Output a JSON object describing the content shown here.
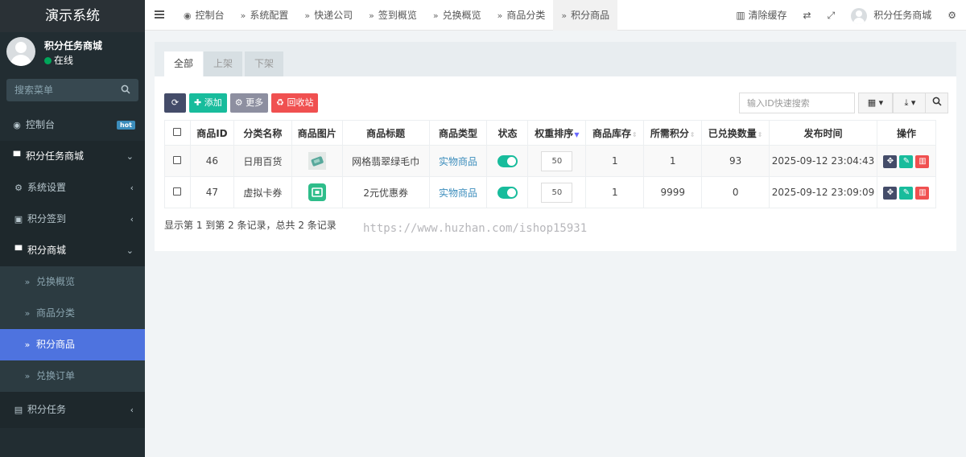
{
  "sidebar": {
    "logo": "演示系统",
    "user": {
      "name": "积分任务商城",
      "status": "在线"
    },
    "search_placeholder": "搜索菜单",
    "hot_badge": "hot",
    "items": [
      {
        "label": "控制台",
        "icon": "dashboard-icon"
      },
      {
        "label": "积分任务商城",
        "icon": "shopping-bag-icon"
      },
      {
        "label": "系统设置",
        "icon": "cogs-icon"
      },
      {
        "label": "积分签到",
        "icon": "calendar-icon"
      },
      {
        "label": "积分商城",
        "icon": "shopping-bag-icon"
      },
      {
        "label": "兑换概览",
        "icon": "double-chevron-icon"
      },
      {
        "label": "商品分类",
        "icon": "double-chevron-icon"
      },
      {
        "label": "积分商品",
        "icon": "double-chevron-icon"
      },
      {
        "label": "兑换订单",
        "icon": "double-chevron-icon"
      },
      {
        "label": "积分任务",
        "icon": "server-icon"
      }
    ]
  },
  "topbar": {
    "tabs": [
      {
        "label": "控制台",
        "icon": "dashboard-icon"
      },
      {
        "label": "系统配置",
        "icon": "double-chevron-icon"
      },
      {
        "label": "快递公司",
        "icon": "double-chevron-icon"
      },
      {
        "label": "签到概览",
        "icon": "double-chevron-icon"
      },
      {
        "label": "兑换概览",
        "icon": "double-chevron-icon"
      },
      {
        "label": "商品分类",
        "icon": "double-chevron-icon"
      },
      {
        "label": "积分商品",
        "icon": "double-chevron-icon"
      }
    ],
    "clear_cache": "清除缓存",
    "username": "积分任务商城"
  },
  "panel_tabs": [
    "全部",
    "上架",
    "下架"
  ],
  "toolbar": {
    "add": "添加",
    "more": "更多",
    "recycle": "回收站",
    "search_placeholder": "输入ID快速搜索"
  },
  "table": {
    "headers": [
      "商品ID",
      "分类名称",
      "商品图片",
      "商品标题",
      "商品类型",
      "状态",
      "权重排序",
      "商品库存",
      "所需积分",
      "已兑换数量",
      "发布时间",
      "操作"
    ],
    "rows": [
      {
        "id": "46",
        "category": "日用百货",
        "title": "网格翡翠绿毛巾",
        "type": "实物商品",
        "weight": "50",
        "stock": "1",
        "points": "1",
        "redeemed": "93",
        "time": "2025-09-12 23:04:43"
      },
      {
        "id": "47",
        "category": "虚拟卡券",
        "title": "2元优惠券",
        "type": "实物商品",
        "weight": "50",
        "stock": "1",
        "points": "9999",
        "redeemed": "0",
        "time": "2025-09-12 23:09:09"
      }
    ]
  },
  "summary": "显示第 1 到第 2 条记录，总共 2 条记录",
  "watermark": "https://www.huzhan.com/ishop15931",
  "colors": {
    "accent": "#4e73df",
    "sidebar_bg": "#222d32",
    "success": "#18bc9c",
    "danger": "#f05050"
  }
}
